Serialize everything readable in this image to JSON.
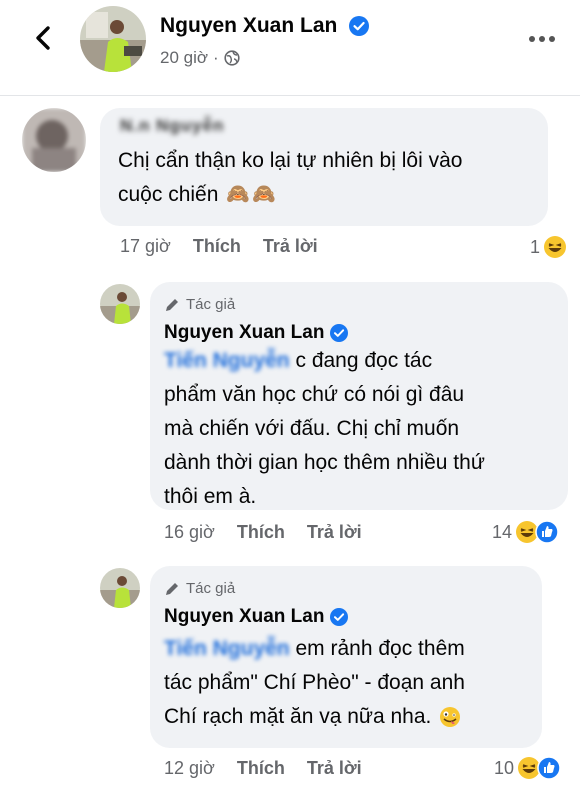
{
  "post": {
    "author": "Nguyen Xuan Lan",
    "time": "20 giờ",
    "dot": "·"
  },
  "comments": [
    {
      "author_blurred": "N.n Nguyễn",
      "text_line1": "Chị cẩn thận ko lại tự nhiên bị lôi vào",
      "text_line2": "cuộc chiến",
      "emojis": "🙈🙈",
      "time": "17 giờ",
      "like_label": "Thích",
      "reply_label": "Trả lời",
      "reaction_count": "1"
    },
    {
      "author_tag": "Tác giả",
      "author": "Nguyen Xuan Lan",
      "mention": "Tiến Nguyễn",
      "text_line1": "c đang đọc tác",
      "text_line2": "phẩm văn học chứ có nói gì đâu",
      "text_line3": "mà chiến với đấu. Chị chỉ muốn",
      "text_line4": "dành thời gian học thêm nhiều thứ",
      "text_line5": "thôi em à.",
      "time": "16 giờ",
      "like_label": "Thích",
      "reply_label": "Trả lời",
      "reaction_count": "14"
    },
    {
      "author_tag": "Tác giả",
      "author": "Nguyen Xuan Lan",
      "mention": "Tiến Nguyễn",
      "text_line1": "em rảnh đọc thêm",
      "text_line2": "tác phẩm\" Chí Phèo\" - đoạn anh",
      "text_line3": "Chí rạch mặt ăn vạ nữa nha.",
      "time": "12 giờ",
      "like_label": "Thích",
      "reply_label": "Trả lời",
      "reaction_count": "10"
    }
  ],
  "icons": [
    "back-arrow-icon",
    "verified-badge-icon",
    "globe-icon",
    "more-options-icon",
    "pencil-icon",
    "haha-reaction-icon",
    "like-reaction-icon",
    "monkey-emoji-icon",
    "zany-face-emoji-icon"
  ],
  "colors": {
    "mention": "#216fdb",
    "verified": "#1877f2",
    "bubble": "#f0f2f5",
    "meta": "#65676b"
  }
}
